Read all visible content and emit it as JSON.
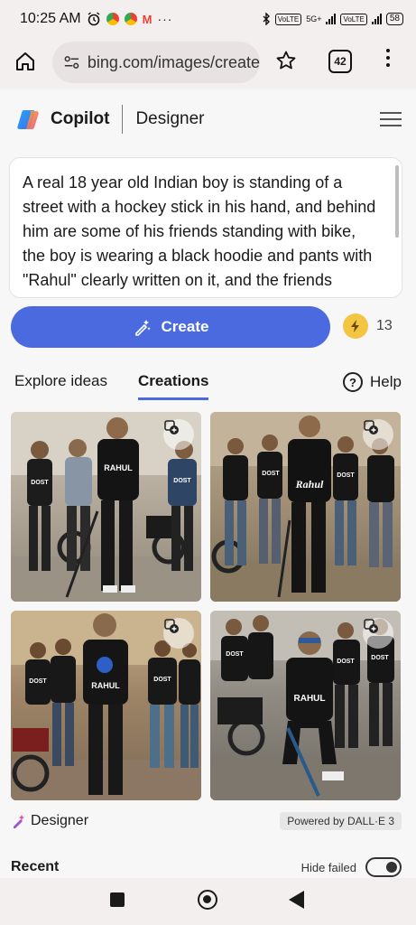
{
  "status_bar": {
    "time": "10:25 AM",
    "battery": "58",
    "net_label_1": "VoLTE",
    "net_label_2": "5G+",
    "net_label_3": "VoLTE"
  },
  "browser": {
    "url": "bing.com/images/create",
    "tab_count": "42"
  },
  "header": {
    "brand": "Copilot",
    "product": "Designer"
  },
  "prompt": {
    "text": "A real 18 year old Indian boy is standing of a street with a hockey stick in his hand, and behind him are some of his friends standing with bike, the boy is wearing a black hoodie and pants with \"Rahul\" clearly written on it, and the friends Hoodie with \"Dost\" written on it"
  },
  "create": {
    "label": "Create",
    "boost_count": "13"
  },
  "tabs": {
    "items": [
      "Explore ideas",
      "Creations"
    ],
    "help_label": "Help"
  },
  "images": [
    {
      "name": "creation-1",
      "hoodie_main": "RAHUL",
      "friends": "DOST"
    },
    {
      "name": "creation-2",
      "hoodie_main": "Rahul",
      "friends": "DOST"
    },
    {
      "name": "creation-3",
      "hoodie_main": "RAHUL",
      "friends": "DOST"
    },
    {
      "name": "creation-4",
      "hoodie_main": "RAHUL",
      "friends": "DOST"
    }
  ],
  "footer": {
    "brand": "Designer",
    "powered_by": "Powered by DALL·E 3"
  },
  "recent": {
    "title": "Recent",
    "hide_failed_label": "Hide failed"
  },
  "colors": {
    "accent": "#4b6ae0",
    "boost": "#f4c542"
  }
}
